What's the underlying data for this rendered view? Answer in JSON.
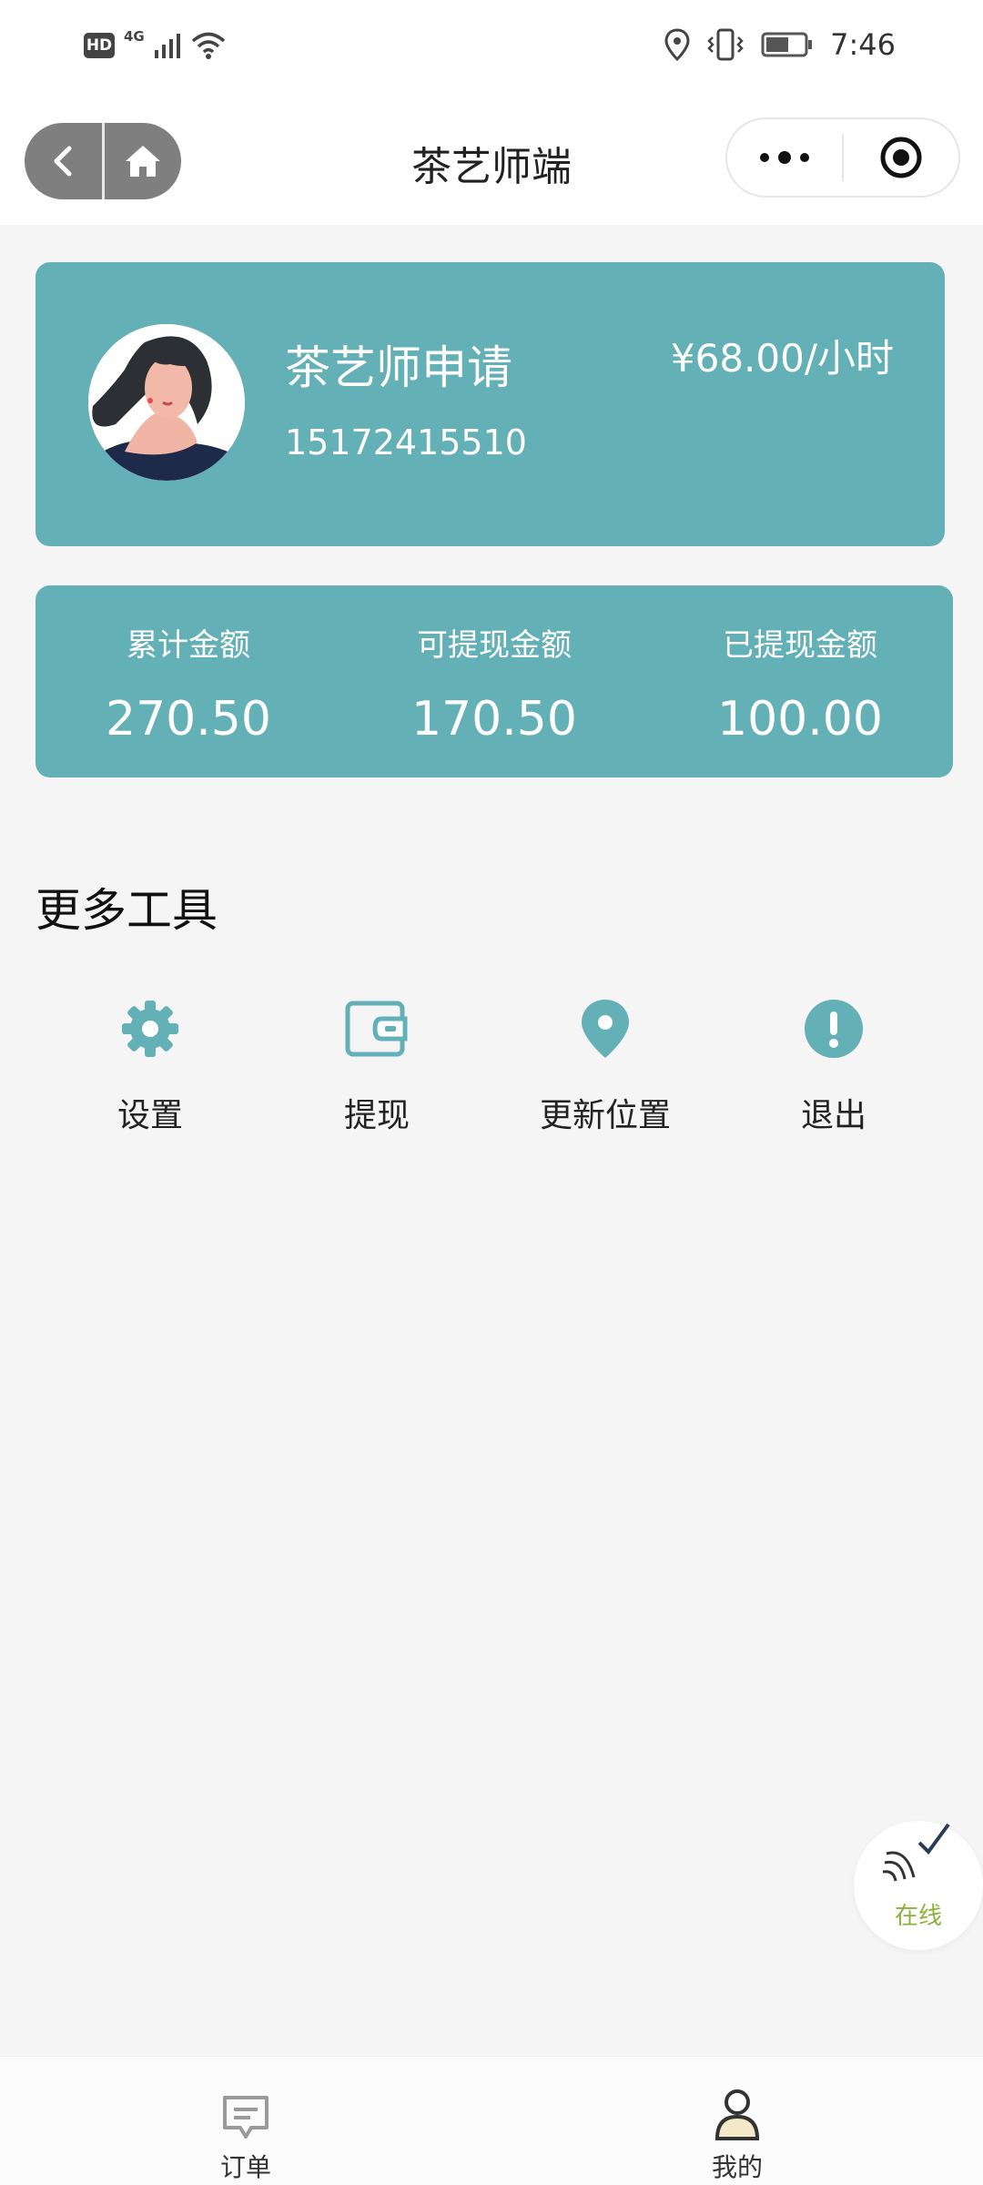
{
  "status_bar": {
    "hd_label": "HD",
    "network_label": "4G",
    "time": "7:46"
  },
  "nav": {
    "title": "茶艺师端",
    "back_icon": "chevron-left-icon",
    "home_icon": "home-icon",
    "more_icon": "more-dots-icon",
    "close_icon": "target-icon"
  },
  "profile": {
    "name": "茶艺师申请",
    "phone": "15172415510",
    "rate": "¥68.00/小时"
  },
  "stats": [
    {
      "label": "累计金额",
      "value": "270.50"
    },
    {
      "label": "可提现金额",
      "value": "170.50"
    },
    {
      "label": "已提现金额",
      "value": "100.00"
    }
  ],
  "tools": {
    "title": "更多工具",
    "items": [
      {
        "label": "设置",
        "icon": "gear-icon"
      },
      {
        "label": "提现",
        "icon": "wallet-icon"
      },
      {
        "label": "更新位置",
        "icon": "location-pin-icon"
      },
      {
        "label": "退出",
        "icon": "exclamation-icon"
      }
    ]
  },
  "online_badge": {
    "label": "在线"
  },
  "tab_bar": {
    "items": [
      {
        "label": "订单",
        "icon": "message-icon"
      },
      {
        "label": "我的",
        "icon": "user-icon"
      }
    ]
  },
  "colors": {
    "accent": "#63b1b6",
    "online": "#8cb23a",
    "capsule": "#7f7f7f"
  }
}
